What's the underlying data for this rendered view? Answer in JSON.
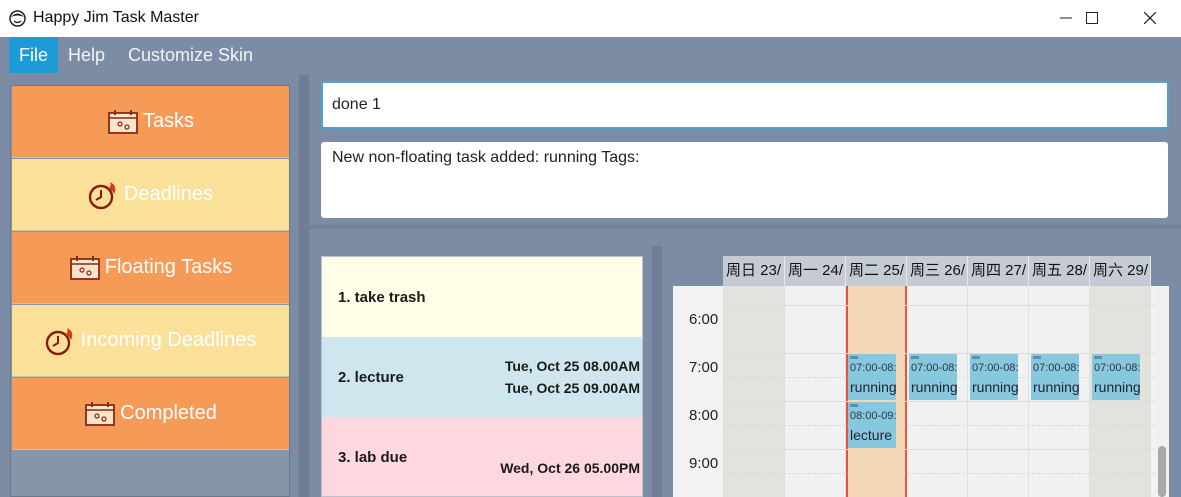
{
  "window": {
    "title": "Happy Jim Task Master"
  },
  "menu": {
    "file": "File",
    "help": "Help",
    "customize": "Customize Skin"
  },
  "sidebar": {
    "items": [
      {
        "label": "Tasks",
        "icon": "calendar-icon"
      },
      {
        "label": "Deadlines",
        "icon": "clock-icon"
      },
      {
        "label": "Floating Tasks",
        "icon": "calendar-icon"
      },
      {
        "label": "Incoming Deadlines",
        "icon": "clock-icon"
      },
      {
        "label": "Completed",
        "icon": "calendar-icon"
      }
    ]
  },
  "command": {
    "value": "done 1"
  },
  "result": {
    "text": "New non-floating task added: running Tags:"
  },
  "tasks": [
    {
      "name": "1. take trash",
      "date1": "",
      "date2": ""
    },
    {
      "name": "2. lecture",
      "date1": "Tue, Oct 25 08.00AM",
      "date2": "Tue, Oct 25 09.00AM"
    },
    {
      "name": "3. lab due",
      "date1": "",
      "date2": "Wed, Oct 26 05.00PM"
    }
  ],
  "calendar": {
    "days": [
      "周日 23/",
      "周一 24/",
      "周二 25/",
      "周三 26/",
      "周四 27/",
      "周五 28/",
      "周六 29/"
    ],
    "times": [
      "6:00",
      "7:00",
      "8:00",
      "9:00"
    ],
    "events": [
      {
        "time": "07:00-08:0",
        "title": "running"
      },
      {
        "time": "07:00-08:0",
        "title": "running"
      },
      {
        "time": "07:00-08:0",
        "title": "running"
      },
      {
        "time": "07:00-08:0",
        "title": "running"
      },
      {
        "time": "07:00-08:0",
        "title": "running"
      },
      {
        "time": "08:00-09:0",
        "title": "lecture"
      }
    ]
  },
  "colors": {
    "accent": "#1e9ad6",
    "sidebar_orange": "#f59a57",
    "sidebar_yellow": "#fbe09a",
    "task_yellow": "#fffde8",
    "task_blue": "#cfe6ef",
    "task_pink": "#fdd8df",
    "today_column": "#f5d9b6",
    "event": "#86c8de"
  }
}
